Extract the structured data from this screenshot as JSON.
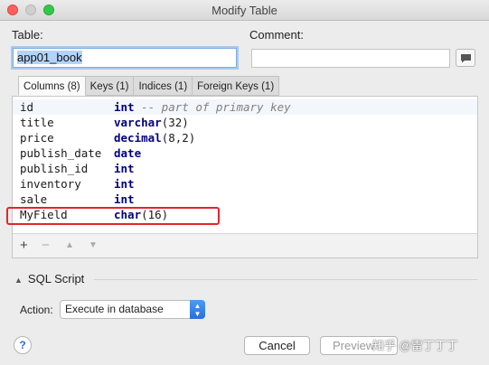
{
  "window": {
    "title": "Modify Table"
  },
  "labels": {
    "table": "Table:",
    "comment": "Comment:"
  },
  "table_name": "app01_book",
  "comment_value": "",
  "tabs": [
    {
      "label": "Columns (8)",
      "active": true
    },
    {
      "label": "Keys (1)",
      "active": false
    },
    {
      "label": "Indices (1)",
      "active": false
    },
    {
      "label": "Foreign Keys (1)",
      "active": false
    }
  ],
  "columns": [
    {
      "name": "id",
      "type": "int",
      "args": "",
      "comment": "-- part of primary key"
    },
    {
      "name": "title",
      "type": "varchar",
      "args": "(32)",
      "comment": ""
    },
    {
      "name": "price",
      "type": "decimal",
      "args": "(8,2)",
      "comment": ""
    },
    {
      "name": "publish_date",
      "type": "date",
      "args": "",
      "comment": ""
    },
    {
      "name": "publish_id",
      "type": "int",
      "args": "",
      "comment": ""
    },
    {
      "name": "inventory",
      "type": "int",
      "args": "",
      "comment": ""
    },
    {
      "name": "sale",
      "type": "int",
      "args": "",
      "comment": ""
    },
    {
      "name": "MyField",
      "type": "char",
      "args": "(16)",
      "comment": ""
    }
  ],
  "toolbar": {
    "add": "+",
    "remove": "−",
    "up": "▲",
    "down": "▼"
  },
  "sql": {
    "header": "SQL Script",
    "action_label": "Action:",
    "action_value": "Execute in database"
  },
  "buttons": {
    "help": "?",
    "cancel": "Cancel",
    "preview": "Preview"
  },
  "watermark": "知乎 @雷丁丁丁",
  "colors": {
    "highlight": "#e0262a",
    "keyword": "#000080",
    "accent": "#2a6fe0"
  }
}
